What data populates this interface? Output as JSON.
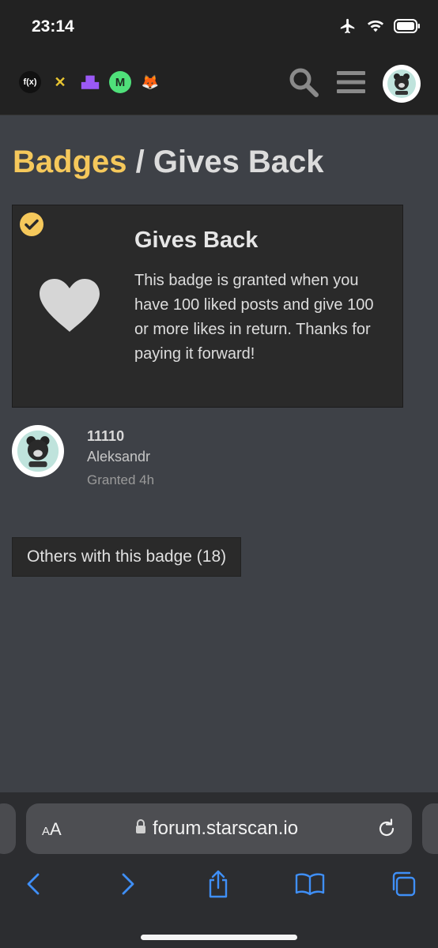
{
  "status_bar": {
    "time": "23:14"
  },
  "header": {
    "logos": [
      {
        "name": "fx-logo",
        "text": "f(x)",
        "bg": "#111111",
        "fg": "#ffffff"
      },
      {
        "name": "x-logo",
        "text": "✕",
        "bg": "transparent",
        "fg": "#e8c531"
      },
      {
        "name": "castle-logo",
        "text": "▟▙",
        "bg": "transparent",
        "fg": "#9b59f6"
      },
      {
        "name": "m-logo",
        "text": "M",
        "bg": "#4fe07a",
        "fg": "#1d2b20"
      },
      {
        "name": "foxchange-logo",
        "text": "🦊",
        "bg": "transparent",
        "fg": "#f08a24"
      }
    ]
  },
  "breadcrumb": {
    "section": "Badges",
    "separator": " / ",
    "current": "Gives Back"
  },
  "badge": {
    "name": "Gives Back",
    "description": "This badge is granted when you have 100 liked posts and give 100 or more likes in return. Thanks for paying it forward!",
    "accent_color": "#f5c85b"
  },
  "grant": {
    "title": "11110",
    "username": "Aleksandr",
    "granted": "Granted 4h"
  },
  "others_button": {
    "label": "Others with this badge (18)"
  },
  "browser": {
    "aa_label_small": "A",
    "aa_label_big": "A",
    "url": "forum.starscan.io",
    "link_color": "#3f8ff7"
  }
}
